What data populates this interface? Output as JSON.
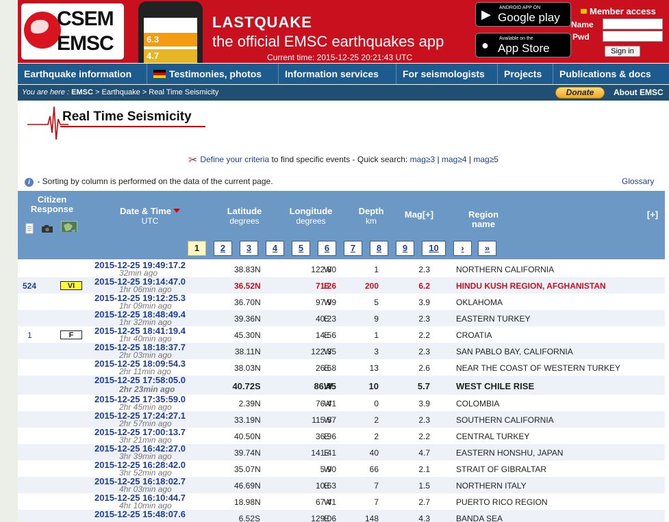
{
  "header": {
    "logo_line1": "CSEM",
    "logo_line2": "EMSC",
    "phone_mag1": "6.3",
    "phone_mag2": "4.7",
    "app_name": "LASTQUAKE",
    "app_tagline": "the official EMSC earthquakes app",
    "current_time": "Current time: 2015-12-25 20:21:43 UTC",
    "google_small": "ANDROID APP ON",
    "google_big": "Google play",
    "apple_small": "Available on the",
    "apple_big": "App Store",
    "member_access": "Member access",
    "name_label": "Name",
    "pwd_label": "Pwd",
    "signin": "Sign in"
  },
  "nav": {
    "items": [
      "Earthquake information",
      "Testimonies, photos",
      "Information services",
      "For seismologists",
      "Projects",
      "Publications & docs"
    ]
  },
  "breadcrumb": {
    "prefix": "You are here :",
    "emsc": "EMSC",
    "rest": " > Earthquake > Real Time Seismicity",
    "donate": "Donate",
    "about": "About EMSC"
  },
  "page": {
    "title": "Real Time Seismicity",
    "criteria_link": "Define your criteria",
    "criteria_text": " to find specific events - Quick search: ",
    "mag3": "mag≥3",
    "mag4": "mag≥4",
    "mag5": "mag≥5",
    "sep": " | ",
    "sort_note": "- Sorting by column is performed on the data of the current page.",
    "glossary": "Glossary"
  },
  "table": {
    "h_citizen1": "Citizen",
    "h_citizen2": "Response",
    "h_date": "Date & Time",
    "h_date_sub": "UTC",
    "h_lat": "Latitude",
    "h_lat_sub": "degrees",
    "h_lon": "Longitude",
    "h_lon_sub": "degrees",
    "h_depth": "Depth",
    "h_depth_sub": "km",
    "h_mag": "Mag[+]",
    "h_region": "Region name",
    "h_plus": "[+]",
    "pages": [
      "1",
      "2",
      "3",
      "4",
      "5",
      "6",
      "7",
      "8",
      "9",
      "10",
      "›",
      "»"
    ],
    "rows": [
      {
        "date": "2015-12-25   19:49:17.2",
        "ago": "32min ago",
        "lat": "38.83",
        "ns": "N",
        "lon": "122.80",
        "ew": "W",
        "depth": "1",
        "mag": "2.3",
        "region": "NORTHERN CALIFORNIA",
        "count": "",
        "intensity": ""
      },
      {
        "date": "2015-12-25   19:14:47.0",
        "ago": "1hr 06min ago",
        "lat": "36.52",
        "ns": "N",
        "lon": "71.26",
        "ew": "E",
        "depth": "200",
        "mag": "6.2",
        "region": "HINDU KUSH REGION, AFGHANISTAN",
        "count": "524",
        "intensity": "VI"
      },
      {
        "date": "2015-12-25   19:12:25.3",
        "ago": "1hr 09min ago",
        "lat": "36.70",
        "ns": "N",
        "lon": "97.99",
        "ew": "W",
        "depth": "5",
        "mag": "3.9",
        "region": "OKLAHOMA",
        "count": "",
        "intensity": ""
      },
      {
        "date": "2015-12-25   18:48:49.4",
        "ago": "1hr 32min ago",
        "lat": "39.36",
        "ns": "N",
        "lon": "40.23",
        "ew": "E",
        "depth": "9",
        "mag": "2.3",
        "region": "EASTERN TURKEY",
        "count": "",
        "intensity": ""
      },
      {
        "date": "2015-12-25   18:41:19.4",
        "ago": "1hr 40min ago",
        "lat": "45.30",
        "ns": "N",
        "lon": "14.56",
        "ew": "E",
        "depth": "1",
        "mag": "2.2",
        "region": "CROATIA",
        "count": "1",
        "intensity": "F"
      },
      {
        "date": "2015-12-25   18:18:37.7",
        "ago": "2hr 03min ago",
        "lat": "38.11",
        "ns": "N",
        "lon": "122.35",
        "ew": "W",
        "depth": "3",
        "mag": "2.3",
        "region": "SAN PABLO BAY, CALIFORNIA",
        "count": "",
        "intensity": ""
      },
      {
        "date": "2015-12-25   18:09:54.3",
        "ago": "2hr 11min ago",
        "lat": "38.03",
        "ns": "N",
        "lon": "26.68",
        "ew": "E",
        "depth": "13",
        "mag": "2.6",
        "region": "NEAR THE COAST OF WESTERN TURKEY",
        "count": "",
        "intensity": ""
      },
      {
        "date": "2015-12-25   17:58:05.0",
        "ago": "2hr 23min ago",
        "lat": "40.72",
        "ns": "S",
        "lon": "86.45",
        "ew": "W",
        "depth": "10",
        "mag": "5.7",
        "region": "WEST CHILE RISE",
        "count": "",
        "intensity": ""
      },
      {
        "date": "2015-12-25   17:35:59.0",
        "ago": "2hr 45min ago",
        "lat": "2.39",
        "ns": "N",
        "lon": "76.41",
        "ew": "W",
        "depth": "0",
        "mag": "3.9",
        "region": "COLOMBIA",
        "count": "",
        "intensity": ""
      },
      {
        "date": "2015-12-25   17:24:27.1",
        "ago": "2hr 57min ago",
        "lat": "33.19",
        "ns": "N",
        "lon": "115.57",
        "ew": "W",
        "depth": "2",
        "mag": "2.3",
        "region": "SOUTHERN CALIFORNIA",
        "count": "",
        "intensity": ""
      },
      {
        "date": "2015-12-25   17:00:13.7",
        "ago": "3hr 21min ago",
        "lat": "40.50",
        "ns": "N",
        "lon": "36.96",
        "ew": "E",
        "depth": "2",
        "mag": "2.2",
        "region": "CENTRAL TURKEY",
        "count": "",
        "intensity": ""
      },
      {
        "date": "2015-12-25   16:42:27.0",
        "ago": "3hr 39min ago",
        "lat": "39.74",
        "ns": "N",
        "lon": "141.41",
        "ew": "E",
        "depth": "40",
        "mag": "4.7",
        "region": "EASTERN HONSHU, JAPAN",
        "count": "",
        "intensity": ""
      },
      {
        "date": "2015-12-25   16:28:42.0",
        "ago": "3hr 52min ago",
        "lat": "35.07",
        "ns": "N",
        "lon": "5.90",
        "ew": "W",
        "depth": "66",
        "mag": "2.1",
        "region": "STRAIT OF GIBRALTAR",
        "count": "",
        "intensity": ""
      },
      {
        "date": "2015-12-25   16:18:02.7",
        "ago": "4hr 03min ago",
        "lat": "46.69",
        "ns": "N",
        "lon": "10.63",
        "ew": "E",
        "depth": "7",
        "mag": "1.5",
        "region": "NORTHERN ITALY",
        "count": "",
        "intensity": ""
      },
      {
        "date": "2015-12-25   16:10:44.7",
        "ago": "4hr 10min ago",
        "lat": "18.98",
        "ns": "N",
        "lon": "67.41",
        "ew": "W",
        "depth": "7",
        "mag": "2.7",
        "region": "PUERTO RICO REGION",
        "count": "",
        "intensity": ""
      },
      {
        "date": "2015-12-25   15:48:07.6",
        "ago": "",
        "lat": "6.52",
        "ns": "S",
        "lon": "129.06",
        "ew": "E",
        "depth": "148",
        "mag": "4.3",
        "region": "BANDA SEA",
        "count": "",
        "intensity": ""
      }
    ]
  },
  "colors": {
    "header_red": "#c8101e",
    "nav_blue": "#1d5a8d",
    "table_header": "#6b98c4",
    "intensity_vi": "#ffff33",
    "highlight_red": "#c8101e"
  }
}
